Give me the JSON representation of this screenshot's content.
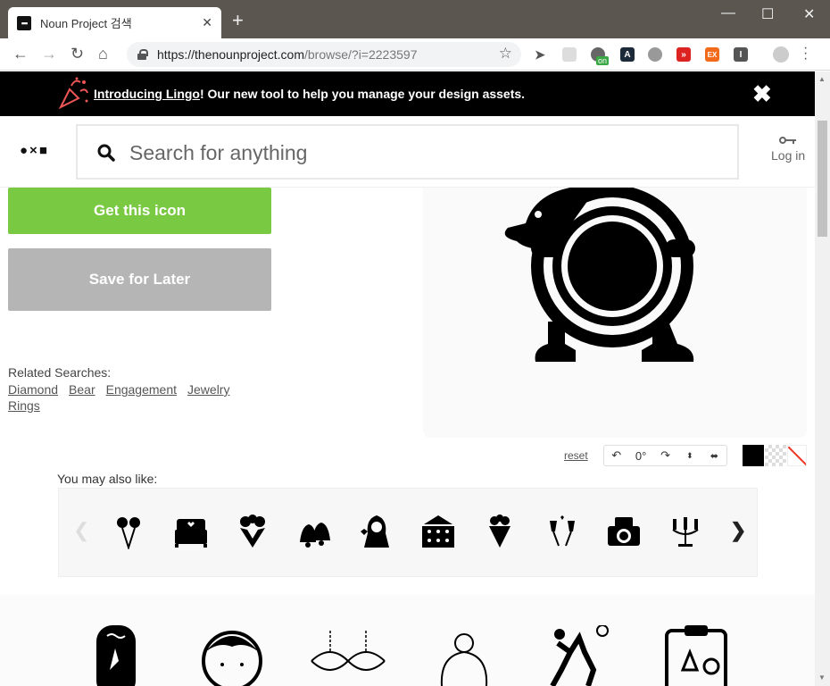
{
  "browser": {
    "tab_title": "Noun Project 검색",
    "tab_close": "✕",
    "new_tab": "+",
    "url_host": "https://thenounproject.com",
    "url_path": "/browse/?i=2223597",
    "ext_on_badge": "on",
    "ext_ex": "EX"
  },
  "banner": {
    "link_text": "Introducing Lingo",
    "rest_text": "! Our new tool to help you manage your design assets.",
    "close": "✖"
  },
  "header": {
    "logo": "●×■",
    "search_placeholder": "Search for anything",
    "login_label": "Log in"
  },
  "actions": {
    "get_icon": "Get this icon",
    "save_later": "Save for Later"
  },
  "related": {
    "label": "Related Searches:",
    "links": [
      "Diamond",
      "Bear",
      "Engagement",
      "Jewelry",
      "Rings"
    ]
  },
  "editor": {
    "reset": "reset",
    "rotation": "0°",
    "colors": {
      "foreground": "#000000",
      "none_stroke": "#ee3322"
    }
  },
  "also_like": {
    "label": "You may also like:",
    "items": [
      "balloons-icon",
      "bed-icon",
      "bouquet-icon",
      "bells-icon",
      "bride-icon",
      "cake-icon",
      "flower-cone-icon",
      "toast-glasses-icon",
      "camera-icon",
      "candelabra-icon"
    ]
  },
  "brand_colors": {
    "green": "#7ac943",
    "gray_button": "#b5b5b5",
    "banner": "#000000"
  }
}
